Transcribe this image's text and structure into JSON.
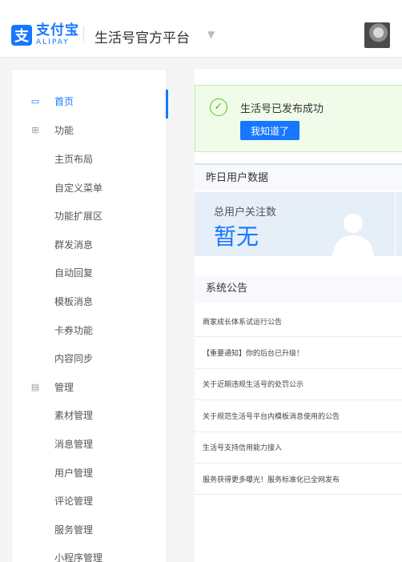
{
  "header": {
    "logo_cn": "支付宝",
    "logo_en": "ALIPAY",
    "platform_title": "生活号官方平台"
  },
  "sidebar": {
    "items": [
      {
        "label": "首页",
        "icon": "monitor-icon",
        "active": true
      },
      {
        "label": "功能",
        "icon": "grid-icon"
      },
      {
        "label": "主页布局"
      },
      {
        "label": "自定义菜单"
      },
      {
        "label": "功能扩展区"
      },
      {
        "label": "群发消息"
      },
      {
        "label": "自动回复"
      },
      {
        "label": "模板消息"
      },
      {
        "label": "卡券功能"
      },
      {
        "label": "内容同步"
      },
      {
        "label": "管理",
        "icon": "folder-icon"
      },
      {
        "label": "素材管理"
      },
      {
        "label": "消息管理"
      },
      {
        "label": "用户管理"
      },
      {
        "label": "评论管理"
      },
      {
        "label": "服务管理"
      },
      {
        "label": "小程序管理"
      }
    ]
  },
  "main": {
    "success_message": "生活号已发布成功",
    "ack_button": "我知道了",
    "yesterday_title": "昨日用户数据",
    "total_followers_label": "总用户关注数",
    "total_followers_value": "暂无",
    "notice_title": "系统公告",
    "notices": [
      "商家成长体系试运行公告",
      "【重要通知】你的后台已升级！",
      "关于近期违规生活号的处罚公示",
      "关于规范生活号平台内模板消息使用的公告",
      "生活号支持信用能力接入",
      "服务获得更多曝光！服务标准化已全网发布"
    ]
  },
  "colors": {
    "accent": "#1677ff",
    "success": "#52c41a",
    "success_bg": "#f1fbe9"
  }
}
